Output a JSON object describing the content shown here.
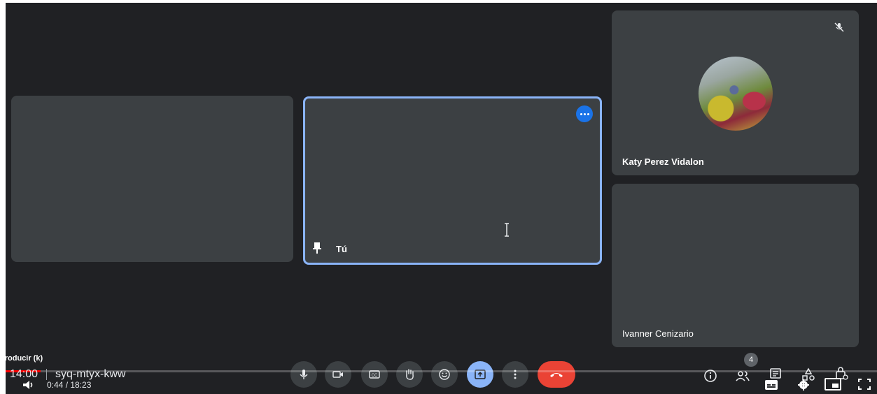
{
  "meeting": {
    "time": "14:00",
    "code": "syq-mtyx-kww"
  },
  "participants": {
    "self_label": "Tú",
    "katy_name": "Katy Perez Vidalon",
    "ivanner_name": "Ivanner Cenizario",
    "count": "4"
  },
  "player": {
    "tooltip": "producir (k)",
    "time_display": "0:44 / 18:23",
    "progress_fraction": 0.04
  },
  "icons": {
    "mic": "mic-icon",
    "camera": "camera-icon",
    "captions": "captions-icon",
    "hand": "raise-hand-icon",
    "emoji": "emoji-icon",
    "present": "present-icon",
    "more": "more-vert-icon",
    "end": "end-call-icon",
    "info": "info-icon",
    "people": "people-icon",
    "chat": "chat-icon",
    "activities": "activities-icon",
    "lock": "lock-icon"
  },
  "colors": {
    "background": "#202124",
    "tile": "#3c4043",
    "active_border": "#8ab4f8",
    "end_call": "#ea4335",
    "progress": "#ff0000"
  }
}
